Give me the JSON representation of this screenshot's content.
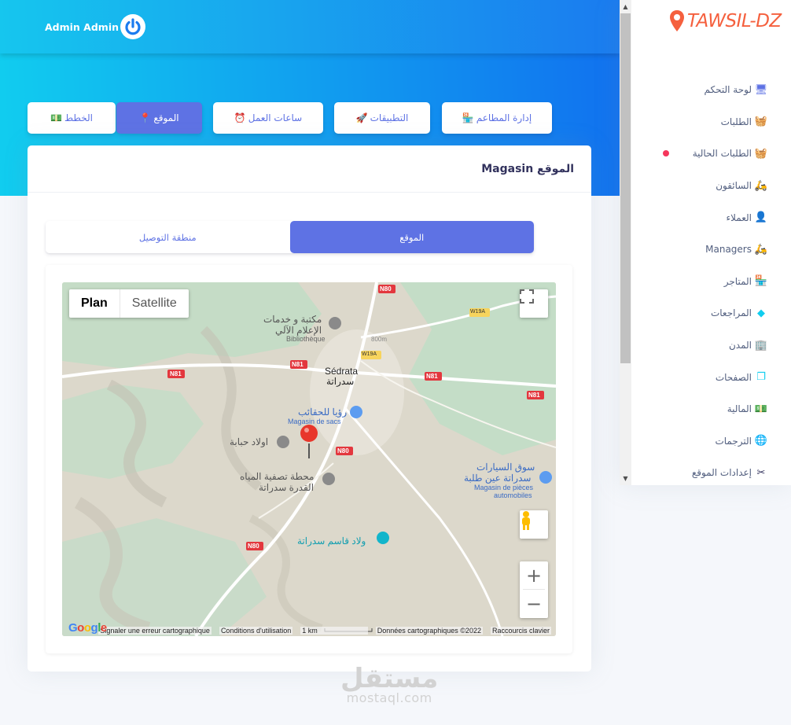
{
  "header": {
    "user_name": "Admin Admin"
  },
  "tabs": [
    {
      "label": "الخطط",
      "icon": "money-icon"
    },
    {
      "label": "الموقع",
      "icon": "map-pin-icon",
      "active": true
    },
    {
      "label": "ساعات العمل",
      "icon": "clock-icon"
    },
    {
      "label": "التطبيقات",
      "icon": "rocket-icon"
    },
    {
      "label": "إدارة المطاعم",
      "icon": "shop-icon"
    }
  ],
  "card": {
    "title": "Magasin الموقع",
    "segments": {
      "delivery_area": "منطقة التوصيل",
      "location": "الموقع"
    }
  },
  "map": {
    "type_plan": "Plan",
    "type_satellite": "Satellite",
    "labels": {
      "n80_top": "N80",
      "w19a_right": "W19A",
      "w19a_mid": "W19A",
      "n81_left": "N81",
      "n81_mid": "N81",
      "n81_right": "N81",
      "n81_lower": "N81",
      "n80_mid": "N80",
      "n80_bottom": "N80",
      "library_ar": "مكتبة و خدمات",
      "library_ar2": "الإعلام الآلي",
      "library_fr": "Bibliothèque",
      "city_fr": "Sédrata",
      "city_ar": "سدراتة",
      "bags_ar": "رؤيا للحقائب",
      "bags_fr": "Magasin de sacs",
      "ouled_ar": "اولاد حبابة",
      "water_ar": "محطة تصفية المياه",
      "water_ar2": "القدرة سدراتة",
      "souk_ar": "سوق السيارات",
      "souk_ar2": "سدراتة عين طلبة",
      "souk_fr": "Magasin de pièces",
      "souk_fr2": "automobiles",
      "kasem_ar": "ولاد قاسم سدراتة",
      "contour_800": "800m"
    },
    "footer": {
      "report": "Signaler une erreur cartographique",
      "terms": "Conditions d'utilisation",
      "scale": "1 km",
      "data": "Données cartographiques ©2022",
      "shortcuts": "Raccourcis clavier"
    },
    "google": "Google"
  },
  "sidebar": {
    "logo": "TAWSIL-DZ",
    "items": [
      {
        "label": "لوحة التحكم",
        "icon": "monitor-icon",
        "color": "#5e72e4"
      },
      {
        "label": "الطلبات",
        "icon": "basket-icon",
        "color": "#f5365c"
      },
      {
        "label": "الطلبات الحالية",
        "icon": "basket-icon",
        "color": "#2dce89"
      },
      {
        "label": "السائقون",
        "icon": "delivery-icon",
        "color": "#f3a4b5"
      },
      {
        "label": "العملاء",
        "icon": "user-icon",
        "color": "#5e72e4"
      },
      {
        "label": "Managers",
        "icon": "manager-icon",
        "color": "#f3a4b5"
      },
      {
        "label": "المتاجر",
        "icon": "shop-icon",
        "color": "#11cdef"
      },
      {
        "label": "المراجعات",
        "icon": "diamond-icon",
        "color": "#11cdef"
      },
      {
        "label": "المدن",
        "icon": "building-icon",
        "color": "#f5365c"
      },
      {
        "label": "الصفحات",
        "icon": "pages-icon",
        "color": "#11cdef"
      },
      {
        "label": "المالية",
        "icon": "money-icon",
        "color": "#5e72e4"
      },
      {
        "label": "الترجمات",
        "icon": "globe-icon",
        "color": "#fb6340"
      },
      {
        "label": "إعدادات الموقع",
        "icon": "tools-icon",
        "color": "#32325d"
      }
    ]
  },
  "watermark": {
    "ar": "مستقل",
    "en": "mostaql.com"
  }
}
